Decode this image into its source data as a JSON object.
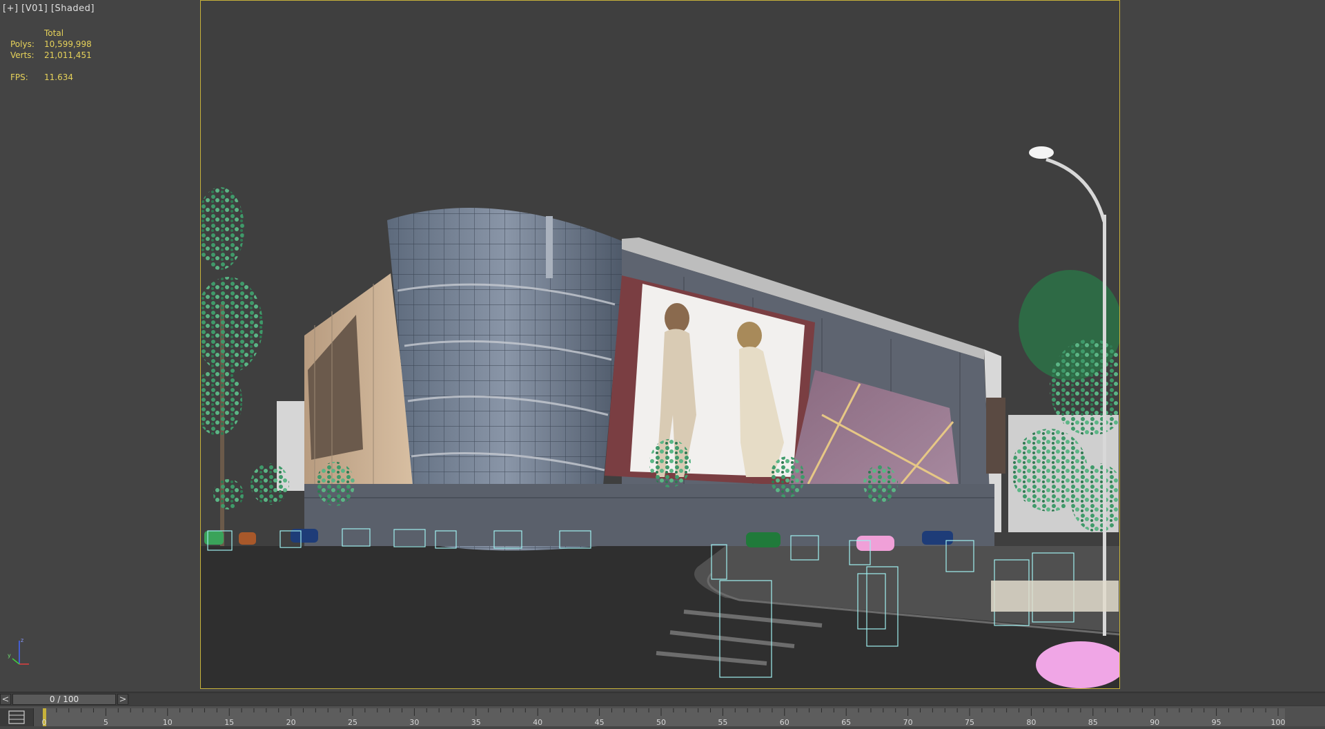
{
  "viewport": {
    "label": "[+] [V01] [Shaded]"
  },
  "stats": {
    "header": "Total",
    "polys_label": "Polys:",
    "polys_value": "10,599,998",
    "verts_label": "Verts:",
    "verts_value": "21,011,451",
    "fps_label": "FPS:",
    "fps_value": "11.634"
  },
  "axis": {
    "z_label": "z",
    "y_label": "y",
    "x_label": "x"
  },
  "time_slider": {
    "prev": "<",
    "next": ">",
    "position_text": "0 / 100",
    "current_frame": 0,
    "total_frames": 100
  },
  "trackbar": {
    "ticks": [
      "0",
      "5",
      "10",
      "15",
      "20",
      "25",
      "30",
      "35",
      "40",
      "45",
      "50",
      "55",
      "60",
      "65",
      "70",
      "75",
      "80",
      "85",
      "90",
      "95",
      "100"
    ]
  },
  "colors": {
    "viewport_bg": "#444444",
    "stats_text": "#e6d25a",
    "safe_frame": "#c7b23a"
  },
  "scene": {
    "billboard_image": "fashion-models-billboard",
    "building": "shopping-mall",
    "foreground": "trees-streetlight-cars-people-wireframes"
  }
}
